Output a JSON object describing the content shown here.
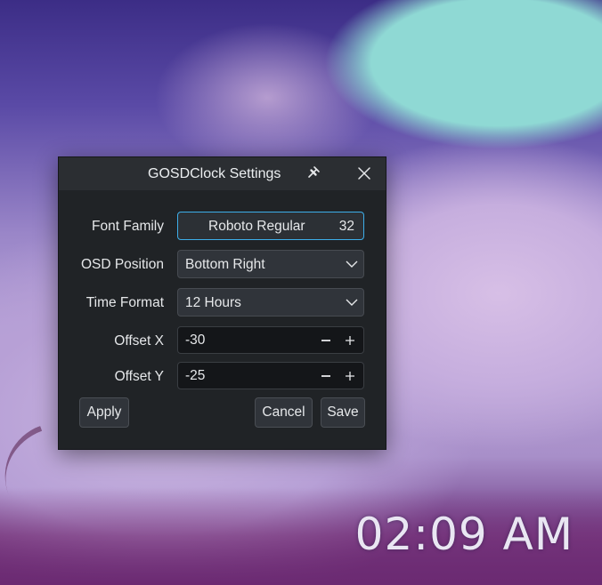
{
  "dialog": {
    "title": "GOSDClock Settings",
    "icons": {
      "pin": "pin-icon",
      "close": "close-icon"
    }
  },
  "form": {
    "font_family": {
      "label": "Font Family",
      "name": "Roboto Regular",
      "size": "32"
    },
    "osd_position": {
      "label": "OSD Position",
      "value": "Bottom Right"
    },
    "time_format": {
      "label": "Time Format",
      "value": "12 Hours"
    },
    "offset_x": {
      "label": "Offset X",
      "value": "-30"
    },
    "offset_y": {
      "label": "Offset Y",
      "value": "-25"
    }
  },
  "buttons": {
    "apply": "Apply",
    "cancel": "Cancel",
    "save": "Save"
  },
  "desktop": {
    "clock": "02:09 AM"
  },
  "colors": {
    "accent": "#3daee9",
    "dialog_bg": "#202326",
    "titlebar_bg": "#2b2e32"
  }
}
